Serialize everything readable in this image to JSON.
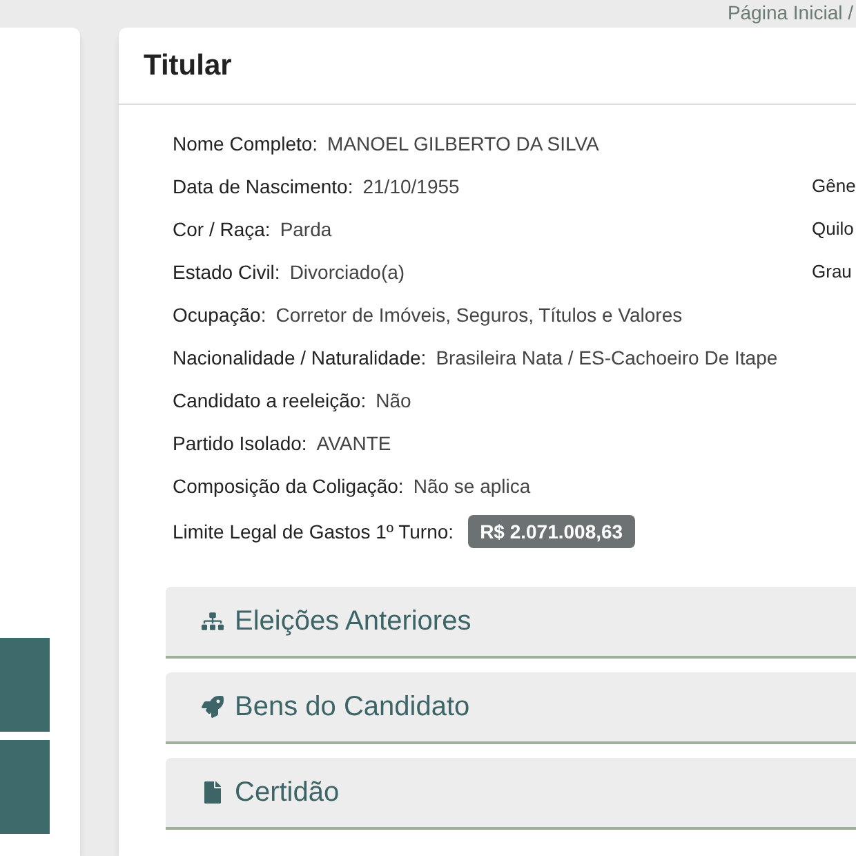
{
  "breadcrumb": "Página Inicial /",
  "card": {
    "title": "Titular"
  },
  "fields": [
    {
      "label": "Nome Completo:",
      "value": "MANOEL GILBERTO DA SILVA"
    },
    {
      "label": "Data de Nascimento:",
      "value": "21/10/1955",
      "side_label": "Gêne"
    },
    {
      "label": "Cor / Raça:",
      "value": "Parda",
      "side_label": "Quilo"
    },
    {
      "label": "Estado Civil:",
      "value": "Divorciado(a)",
      "side_label": "Grau"
    },
    {
      "label": "Ocupação:",
      "value": "Corretor de Imóveis, Seguros, Títulos e Valores"
    },
    {
      "label": "Nacionalidade / Naturalidade:",
      "value": "Brasileira Nata / ES-Cachoeiro De Itape"
    },
    {
      "label": "Candidato a reeleição:",
      "value": "Não"
    },
    {
      "label": "Partido Isolado:",
      "value": "AVANTE"
    },
    {
      "label": "Composição da Coligação:",
      "value": "Não se aplica"
    },
    {
      "label": "Limite Legal de Gastos 1º Turno:",
      "value": "R$ 2.071.008,63",
      "kind": "badge"
    }
  ],
  "sections": [
    {
      "label": "Eleições Anteriores"
    },
    {
      "label": "Bens do Candidato"
    },
    {
      "label": "Certidão"
    }
  ]
}
